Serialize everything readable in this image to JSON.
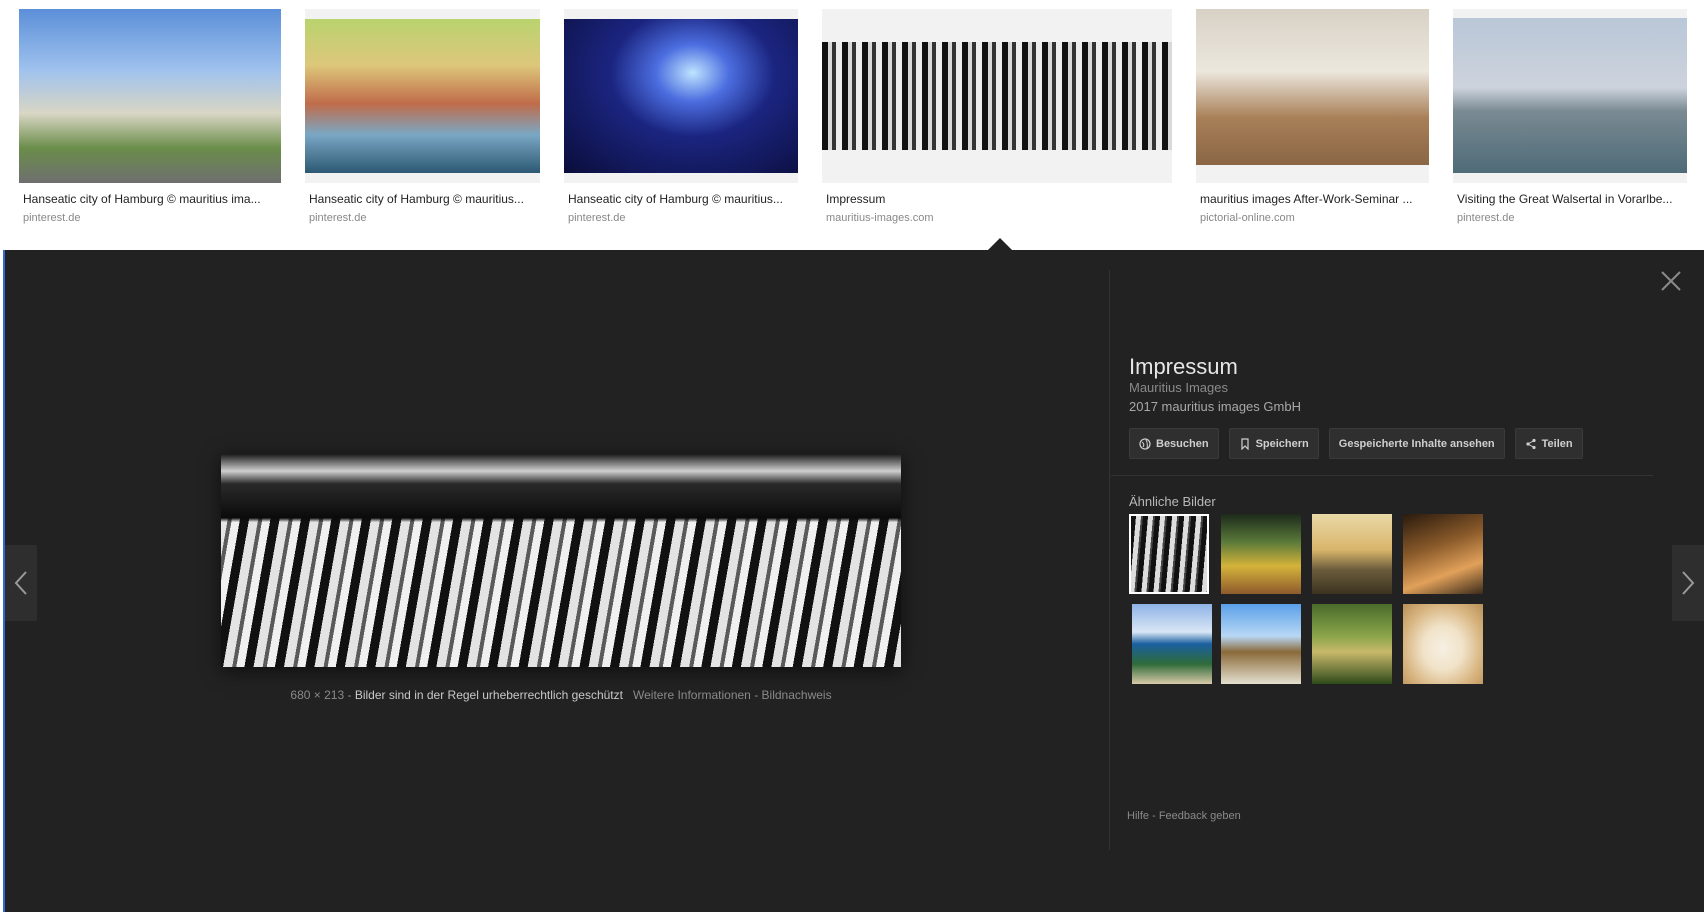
{
  "results": [
    {
      "title": "Hanseatic city of Hamburg © mauritius ima...",
      "source": "pinterest.de"
    },
    {
      "title": "Hanseatic city of Hamburg © mauritius...",
      "source": "pinterest.de"
    },
    {
      "title": "Hanseatic city of Hamburg © mauritius...",
      "source": "pinterest.de"
    },
    {
      "title": "Impressum",
      "source": "mauritius-images.com"
    },
    {
      "title": "mauritius images After-Work-Seminar ...",
      "source": "pictorial-online.com"
    },
    {
      "title": "Visiting the Great Walsertal in Vorarlbe...",
      "source": "pinterest.de"
    }
  ],
  "detail": {
    "title": "Impressum",
    "subtitle": "Mauritius Images",
    "meta": "2017 mauritius images GmbH",
    "actions": {
      "visit": "Besuchen",
      "save": "Speichern",
      "view_saved": "Gespeicherte Inhalte ansehen",
      "share": "Teilen"
    },
    "caption": {
      "dimensions": "680 × 213",
      "separator": "-",
      "copyright": "Bilder sind in der Regel urheberrechtlich geschützt",
      "more_info": "Weitere Informationen",
      "credits": "Bildnachweis"
    },
    "similar_label": "Ähnliche Bilder",
    "footer": {
      "help": "Hilfe",
      "separator": "-",
      "feedback": "Feedback geben"
    }
  },
  "icons": {
    "close": "close-icon",
    "prev": "chevron-left-icon",
    "next": "chevron-right-icon",
    "visit": "globe-icon",
    "save": "bookmark-icon",
    "share": "share-icon"
  },
  "colors": {
    "panel_background": "#222222",
    "accent": "#3367d6"
  }
}
